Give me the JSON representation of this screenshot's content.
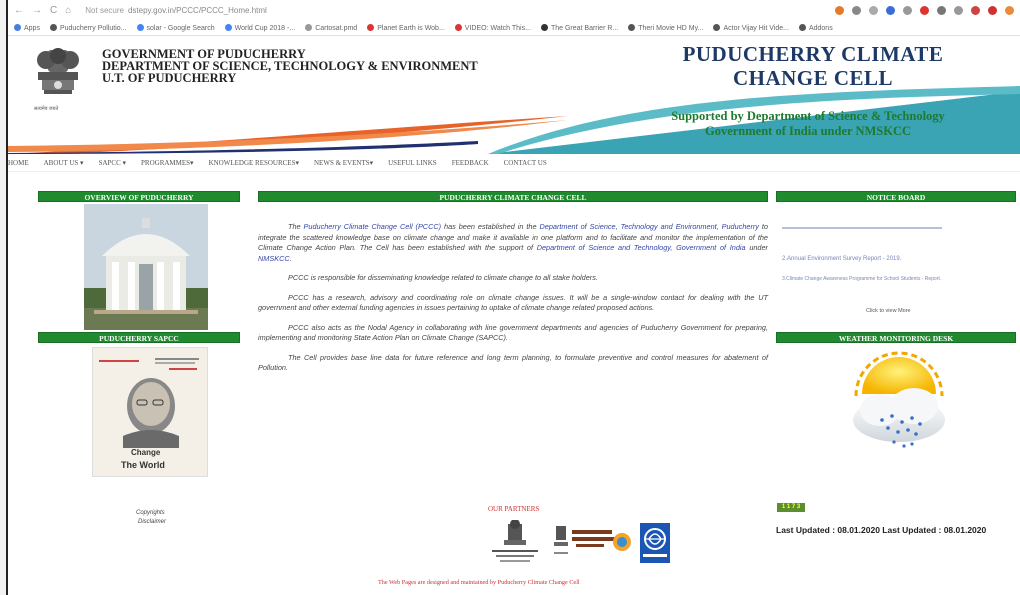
{
  "browser": {
    "url_prefix": "Not secure",
    "url": "dstepy.gov.in/PCCC/PCCC_Home.html",
    "bookmarks": [
      "Apps",
      "Puducherry Pollutio...",
      "solar - Google Search",
      "World Cup 2018 -...",
      "Cartosat.pmd",
      "Planet Earth is Wob...",
      "VIDEO: Watch This...",
      "The Great Barrier R...",
      "Theri Movie HD My...",
      "Actor Vijay Hit Vide...",
      "Addons"
    ]
  },
  "header": {
    "gov_line1": "GOVERNMENT OF PUDUCHERRY",
    "gov_line2": "DEPARTMENT OF SCIENCE, TECHNOLOGY & ENVIRONMENT",
    "gov_line3": "U.T. OF PUDUCHERRY",
    "emblem_caption": "सत्यमेव जयते",
    "title_line1": "PUDUCHERRY CLIMATE",
    "title_line2": "CHANGE CELL",
    "support_line1": "Supported by Department of Science & Technology",
    "support_line2": "Government of India under NMSKCC"
  },
  "nav": [
    "HOME",
    "ABOUT US ▾",
    "SAPCC ▾",
    "PROGRAMMES▾",
    "KNOWLEDGE RESOURCES▾",
    "NEWS & EVENTS▾",
    "USEFUL LINKS",
    "FEEDBACK",
    "CONTACT US"
  ],
  "left": {
    "overview_title": "OVERVIEW OF PUDUCHERRY",
    "sapcc_title": "PUDUCHERRY SAPCC",
    "book_text_1": "Change",
    "book_text_2": "The World",
    "copyrights": "Copyrights",
    "disclaimer": "Disclaimer"
  },
  "center": {
    "title": "PUDUCHERRY CLIMATE CHANGE CELL",
    "p1_a": "The ",
    "p1_link1": "Puducherry Climate Change Cell (PCCC)",
    "p1_b": " has been established in the ",
    "p1_link2": "Department of Science, Technology and Environment, Puducherry",
    "p1_c": " to integrate the scattered knowledge base on climate change and make it available in one platform and to facilitate and monitor the implementation of the Climate Change Action Plan. The Cell has been established  with the support of ",
    "p1_link3": "Department of Science and Technology, Government of India",
    "p1_d": " under ",
    "p1_link4": "NMSKCC",
    "p1_e": ".",
    "p2": "PCCC is responsible for disseminating knowledge related to climate change to all stake holders.",
    "p3": "PCCC has a research, advisory and coordinating role on climate change issues. It will be a single-window contact for dealing with the UT government and other external funding agencies in issues pertaining to uptake of climate change related proposed actions.",
    "p4": "PCCC also acts as the Nodal Agency in collaborating with line government departments and agencies of Puducherry Government for preparing, implementing and monitoring State Action Plan on Climate Change (SAPCC).",
    "p5": "The Cell provides base line data for future reference and long term planning, to formulate preventive and control measures for abatement of Pollution.",
    "partners_title": "OUR PARTNERS",
    "footer": "The Web Pages are designed and maintained by Puducherry Climate Change Cell"
  },
  "right": {
    "notice_title": "NOTICE BOARD",
    "notice_1": "2.Annual Environment Survey Report - 2019.",
    "notice_2": "3.Climate Change Awareness Programme for School Students - Report.",
    "click_more": "Click to view More",
    "weather_title": "WEATHER MONITORING DESK",
    "counter": "1 1 7 3",
    "last_updated": "Last Updated : 08.01.2020 Last Updated : 08.01.2020"
  },
  "colors": {
    "green_bar": "#1f8a2e",
    "teal": "#3a9fb0",
    "orange": "#e8632a",
    "title_blue": "#1d3a66"
  }
}
